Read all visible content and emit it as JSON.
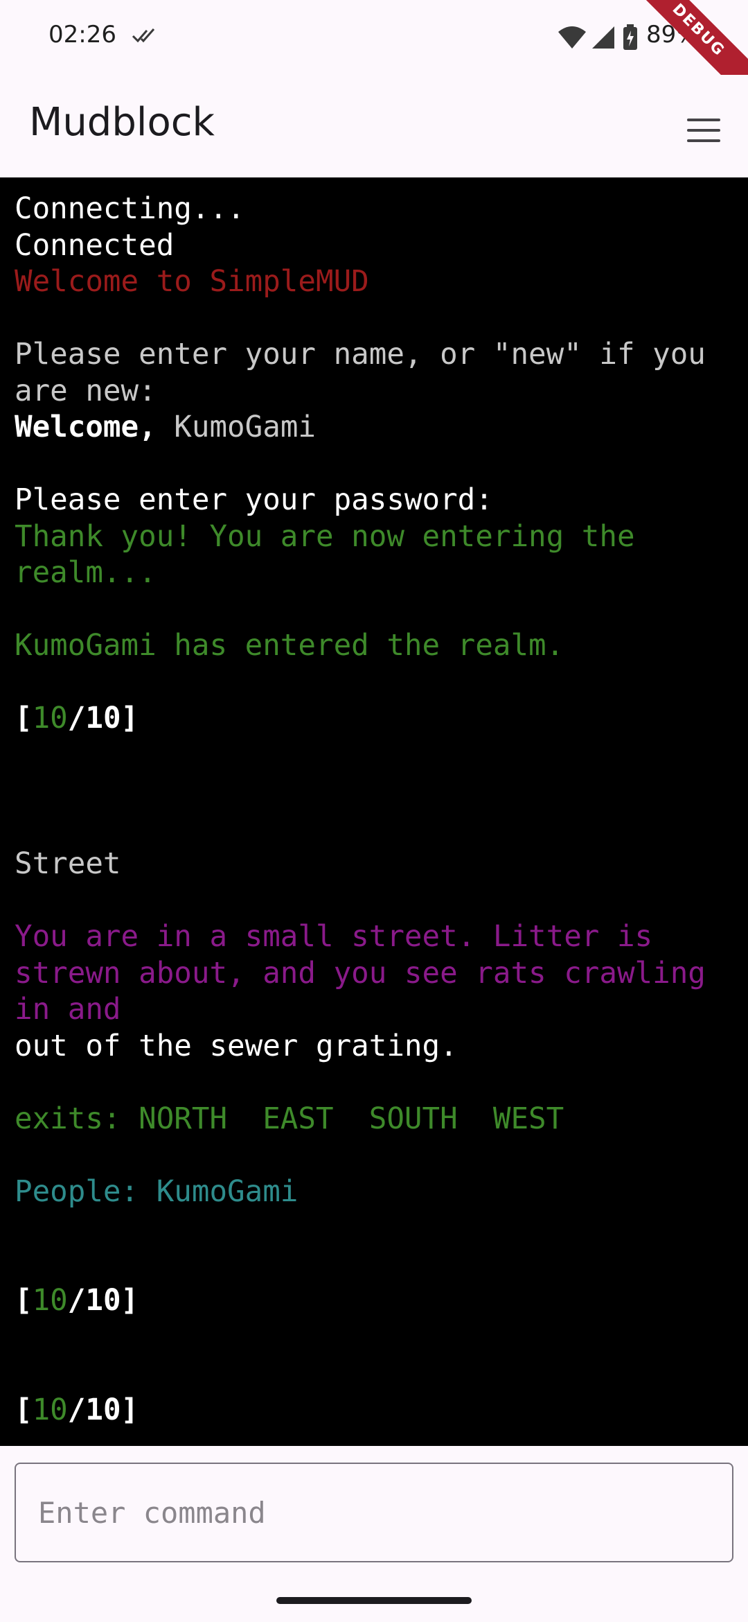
{
  "status_bar": {
    "time": "02:26",
    "battery": "89%",
    "debug_label": "DEBUG"
  },
  "app_bar": {
    "title": "Mudblock",
    "menu_icon": "hamburger-menu-icon"
  },
  "colors": {
    "terminal_bg": "#000000",
    "white": "#ffffff",
    "grey": "#c8c8c8",
    "red": "#9b1b1b",
    "green": "#3e8a2a",
    "purple": "#8a1a8a",
    "teal": "#2e8c8c"
  },
  "terminal": {
    "lines": [
      {
        "segments": [
          {
            "text": "Connecting...",
            "color": "white"
          }
        ]
      },
      {
        "segments": [
          {
            "text": "Connected",
            "color": "white"
          }
        ]
      },
      {
        "segments": [
          {
            "text": "Welcome to SimpleMUD",
            "color": "red"
          }
        ]
      },
      {
        "segments": []
      },
      {
        "segments": [
          {
            "text": "Please enter your name, or \"new\" if you are new:",
            "color": "grey"
          }
        ]
      },
      {
        "segments": [
          {
            "text": "Welcome, ",
            "color": "white",
            "bold": true
          },
          {
            "text": "KumoGami",
            "color": "grey"
          }
        ]
      },
      {
        "segments": []
      },
      {
        "segments": [
          {
            "text": "Please enter your password:",
            "color": "white"
          }
        ]
      },
      {
        "segments": [
          {
            "text": "Thank you! You are now entering the realm...",
            "color": "green"
          }
        ]
      },
      {
        "segments": []
      },
      {
        "segments": [
          {
            "text": "KumoGami has entered the realm.",
            "color": "green"
          }
        ]
      },
      {
        "segments": []
      },
      {
        "segments": [
          {
            "text": "[",
            "color": "white",
            "bold": true
          },
          {
            "text": "10",
            "color": "green"
          },
          {
            "text": "/10]",
            "color": "white",
            "bold": true
          }
        ]
      },
      {
        "segments": []
      },
      {
        "segments": []
      },
      {
        "segments": []
      },
      {
        "segments": [
          {
            "text": "Street",
            "color": "grey"
          }
        ]
      },
      {
        "segments": []
      },
      {
        "segments": [
          {
            "text": "You are in a small street. Litter is strewn about, and you see rats crawling in and",
            "color": "purple"
          }
        ]
      },
      {
        "segments": [
          {
            "text": "out of the sewer grating.",
            "color": "white"
          }
        ]
      },
      {
        "segments": []
      },
      {
        "segments": [
          {
            "text": "exits: NORTH  EAST  SOUTH  WEST",
            "color": "green"
          }
        ]
      },
      {
        "segments": []
      },
      {
        "segments": [
          {
            "text": "People: KumoGami",
            "color": "teal"
          }
        ]
      },
      {
        "segments": []
      },
      {
        "segments": []
      },
      {
        "segments": [
          {
            "text": "[",
            "color": "white",
            "bold": true
          },
          {
            "text": "10",
            "color": "green"
          },
          {
            "text": "/10]",
            "color": "white",
            "bold": true
          }
        ]
      },
      {
        "segments": []
      },
      {
        "segments": []
      },
      {
        "segments": [
          {
            "text": "[",
            "color": "white",
            "bold": true
          },
          {
            "text": "10",
            "color": "green"
          },
          {
            "text": "/10]",
            "color": "white",
            "bold": true
          }
        ]
      }
    ]
  },
  "input": {
    "placeholder": "Enter command",
    "value": ""
  }
}
